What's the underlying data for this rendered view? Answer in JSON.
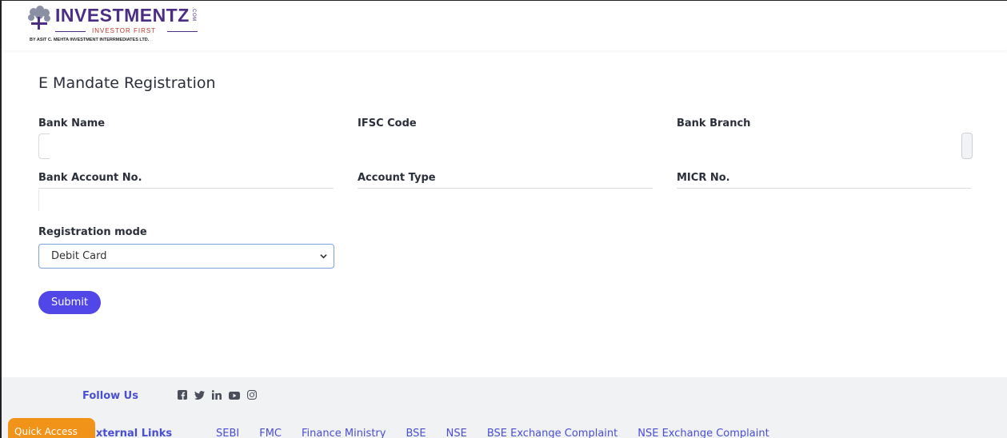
{
  "brand": {
    "name": "INVESTMENTZ",
    "com": ".COM",
    "tagline": "INVESTOR FIRST",
    "by_line": "BY ASIT C. MEHTA INVESTMENT INTERRMEDIATES LTD."
  },
  "page": {
    "title": "E Mandate Registration"
  },
  "form": {
    "bank_name_label": "Bank Name",
    "ifsc_label": "IFSC Code",
    "bank_branch_label": "Bank Branch",
    "account_no_label": "Bank Account No.",
    "account_type_label": "Account Type",
    "micr_label": "MICR No.",
    "registration_mode_label": "Registration mode",
    "registration_mode_value": "Debit Card",
    "submit_label": "Submit"
  },
  "footer": {
    "follow_label": "Follow Us",
    "social_icons": [
      "facebook-icon",
      "twitter-icon",
      "linkedin-icon",
      "youtube-icon",
      "instagram-icon"
    ],
    "links_label": "External Links",
    "links": [
      "SEBI",
      "FMC",
      "Finance Ministry",
      "BSE",
      "NSE",
      "BSE Exchange Complaint",
      "NSE Exchange Complaint"
    ],
    "quick_access": "Quick Access"
  },
  "colors": {
    "brand_purple": "#4b2e83",
    "submit_bg": "#5146e8",
    "link": "#4a4fd1",
    "quick_access_bg": "#f29319"
  }
}
